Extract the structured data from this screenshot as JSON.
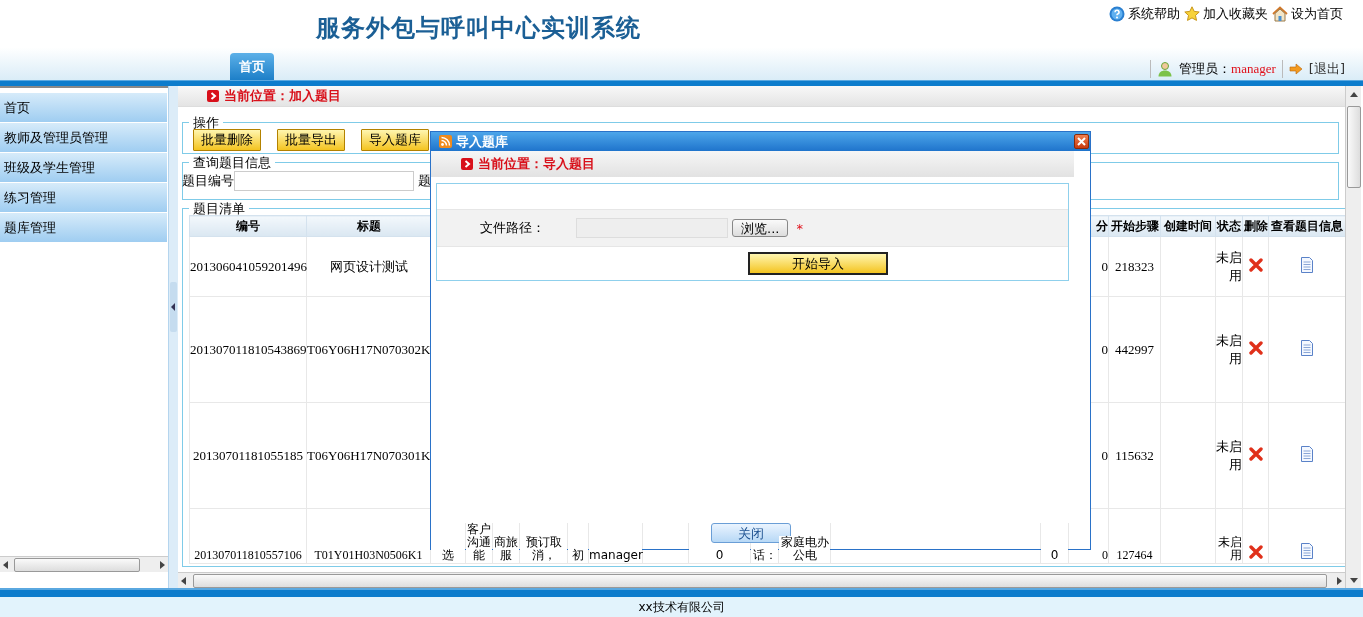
{
  "header": {
    "title": "服务外包与呼叫中心实训系统",
    "links": [
      {
        "label": "系统帮助"
      },
      {
        "label": "加入收藏夹"
      },
      {
        "label": "设为首页"
      }
    ],
    "tabs": [
      {
        "label": "首页",
        "selected": true
      }
    ],
    "user": {
      "role_label": "管理员：",
      "name": "manager"
    },
    "logout": "[退出]"
  },
  "sidebar": {
    "items": [
      {
        "label": "首页"
      },
      {
        "label": "教师及管理员管理"
      },
      {
        "label": "班级及学生管理"
      },
      {
        "label": "练习管理"
      },
      {
        "label": "题库管理"
      }
    ]
  },
  "breadcrumb": "当前位置：加入题目",
  "actions": {
    "legend": "操作",
    "buttons": [
      "批量删除",
      "批量导出",
      "导入题库"
    ]
  },
  "query": {
    "legend": "查询题目信息",
    "fields": [
      {
        "label": "题目编号"
      },
      {
        "label": "题"
      }
    ]
  },
  "list": {
    "legend": "题目清单",
    "columns": [
      {
        "label": "编号"
      },
      {
        "label": "标题"
      },
      {
        "label": "分"
      },
      {
        "label": "开始步骤"
      },
      {
        "label": "创建时间"
      },
      {
        "label": "状态"
      },
      {
        "label": "删除"
      },
      {
        "label": "查看题目信息"
      }
    ],
    "rows": [
      {
        "id": "201306041059201496",
        "title": "网页设计测试",
        "score": "0",
        "start_step": "218323",
        "status": "未启用"
      },
      {
        "id": "201307011810543869",
        "title": "T06Y06H17N070302K",
        "score": "0",
        "start_step": "442997",
        "status": "未启用"
      },
      {
        "id": "20130701181055185",
        "title": "T06Y06H17N070301K",
        "score": "0",
        "start_step": "115632",
        "status": "未启用"
      },
      {
        "id": "201307011810557106",
        "title": "T01Y01H03N0506K1",
        "middle": [
          "选",
          "客户沟通能",
          "商旅服",
          "预订取消，",
          "初",
          "manager",
          "0",
          "话：",
          "家庭电办公电",
          "0"
        ],
        "score": "0",
        "start_step": "127464",
        "status": "未启用"
      }
    ]
  },
  "dialog": {
    "title": "导入题库",
    "breadcrumb": "当前位置：导入题目",
    "field_label": "文件路径：",
    "browse_button": "浏览...",
    "required_mark": "*",
    "submit_button": "开始导入",
    "close_button": "关闭"
  },
  "footer": "xx技术有限公司"
}
